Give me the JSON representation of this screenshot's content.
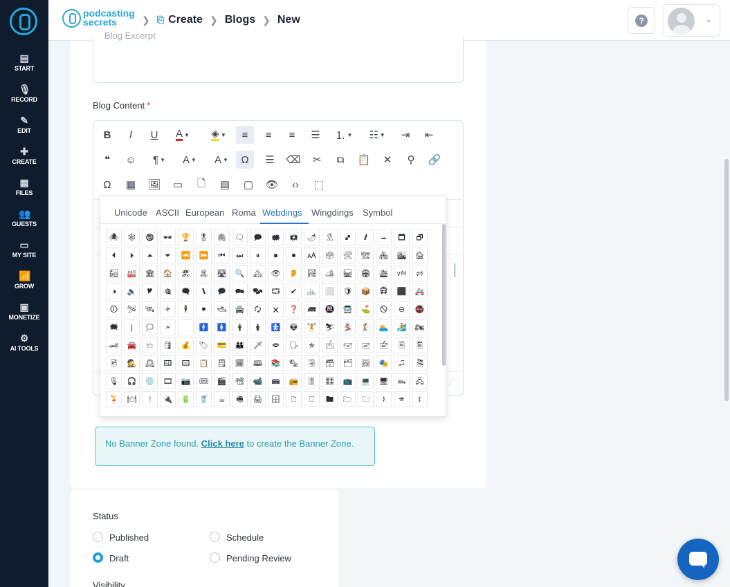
{
  "sidebar": {
    "items": [
      {
        "label": "START",
        "icon": "start-icon"
      },
      {
        "label": "RECORD",
        "icon": "microphone-icon"
      },
      {
        "label": "EDIT",
        "icon": "edit-icon"
      },
      {
        "label": "CREATE",
        "icon": "create-icon"
      },
      {
        "label": "FILES",
        "icon": "files-icon"
      },
      {
        "label": "GUESTS",
        "icon": "guests-icon"
      },
      {
        "label": "MY SITE",
        "icon": "site-icon"
      },
      {
        "label": "GROW",
        "icon": "grow-icon"
      },
      {
        "label": "MONETIZE",
        "icon": "monetize-icon"
      },
      {
        "label": "AI TOOLS",
        "icon": "ai-tools-icon"
      }
    ]
  },
  "header": {
    "brand_line1": "podcasting",
    "brand_line2": "secrets",
    "breadcrumbs": [
      "Create",
      "Blogs",
      "New"
    ],
    "help_glyph": "?"
  },
  "form": {
    "excerpt_placeholder": "Blog Excerpt",
    "content_label": "Blog Content",
    "required_mark": "*"
  },
  "special_chars": {
    "tabs": [
      "Unicode",
      "ASCII",
      "European",
      "Roma",
      "Webdings",
      "Wingdings",
      "Symbol"
    ],
    "active_tab": "Webdings",
    "rows": [
      [
        "🕷",
        "🕸",
        "🕲",
        "🕶",
        "🏆",
        "🎖",
        "🖇",
        "🗨",
        "🗩",
        "🗰",
        "🗱",
        "🌶",
        "🎗",
        "🙾",
        "🙼",
        "🗕",
        "🗖",
        "🗗"
      ],
      [
        "⏴",
        "⏵",
        "⏶",
        "⏷",
        "⏪",
        "⏩",
        "⏮",
        "⏭",
        "⏸",
        "⏹",
        "⏺",
        "🗚",
        "🗳",
        "🛠",
        "🏗",
        "🏘",
        "🏙",
        "🏚"
      ],
      [
        "🏜",
        "🏭",
        "🏛",
        "🏠",
        "🏖",
        "🏝",
        "🛣",
        "🔍",
        "🏔",
        "👁",
        "👂",
        "🏞",
        "🏕",
        "🛤",
        "🏟",
        "🛳",
        "🕬",
        "🕫"
      ],
      [
        "🕨",
        "🔈",
        "🎔",
        "🎕",
        "🗬",
        "🙽",
        "🗭",
        "🗪",
        "🗫",
        "⮔",
        "✔",
        "🚲",
        "⬜",
        "🛡",
        "📦",
        "🛱",
        "⬛",
        "🚑"
      ],
      [
        "🛈",
        "🛩",
        "🛰",
        "🟈",
        "🕴",
        "⚫",
        "🛥",
        "🚔",
        "🗘",
        "🗙",
        "❓",
        "🛲",
        "🚇",
        "🚍",
        "⛳",
        "🛇",
        "⊖",
        "🚭"
      ],
      [
        "🗮",
        "|",
        "🗯",
        "🗲",
        "",
        "🚹",
        "🚺",
        "🛉",
        "🛊",
        "🚼",
        "👽",
        "🏋",
        "⛷",
        "🏂",
        "🏌",
        "🏊",
        "🏄",
        "🏍"
      ],
      [
        "🏎",
        "🚘",
        "🗠",
        "🛢",
        "💰",
        "🏷",
        "💳",
        "👪",
        "🗡",
        "🗢",
        "🗣",
        "✯",
        "🖄",
        "🖅",
        "🖃",
        "🖆",
        "🖹",
        "🖺"
      ],
      [
        "🖻",
        "🕵",
        "🕰",
        "🖽",
        "🖾",
        "📋",
        "🗒",
        "🗓",
        "🕮",
        "📚",
        "🗞",
        "🗟",
        "🗃",
        "🗂",
        "🖼",
        "🎭",
        "🎜",
        "🎘"
      ],
      [
        "🎙",
        "🎧",
        "💿",
        "🎞",
        "📷",
        "🎟",
        "🎬",
        "📽",
        "📹",
        "📾",
        "📻",
        "🎚",
        "🎛",
        "📺",
        "💻",
        "🖥",
        "🖦",
        "🖧"
      ],
      [
        "🍹",
        "🍽",
        "🕯",
        "🔌",
        "🔋",
        "🥤",
        "☕",
        "🖷",
        "🖨",
        "🗄",
        "🗅",
        "🗆",
        "🖿",
        "🗁",
        "🗀",
        "🕽",
        "🕾",
        "🕻"
      ]
    ]
  },
  "banner": {
    "text_before": "No Banner Zone found. ",
    "link_text": "Click here",
    "text_after": " to create the Banner Zone."
  },
  "status": {
    "title": "Status",
    "options": [
      "Published",
      "Schedule",
      "Draft",
      "Pending Review"
    ],
    "selected": "Draft"
  },
  "visibility": {
    "title": "Visibility"
  }
}
